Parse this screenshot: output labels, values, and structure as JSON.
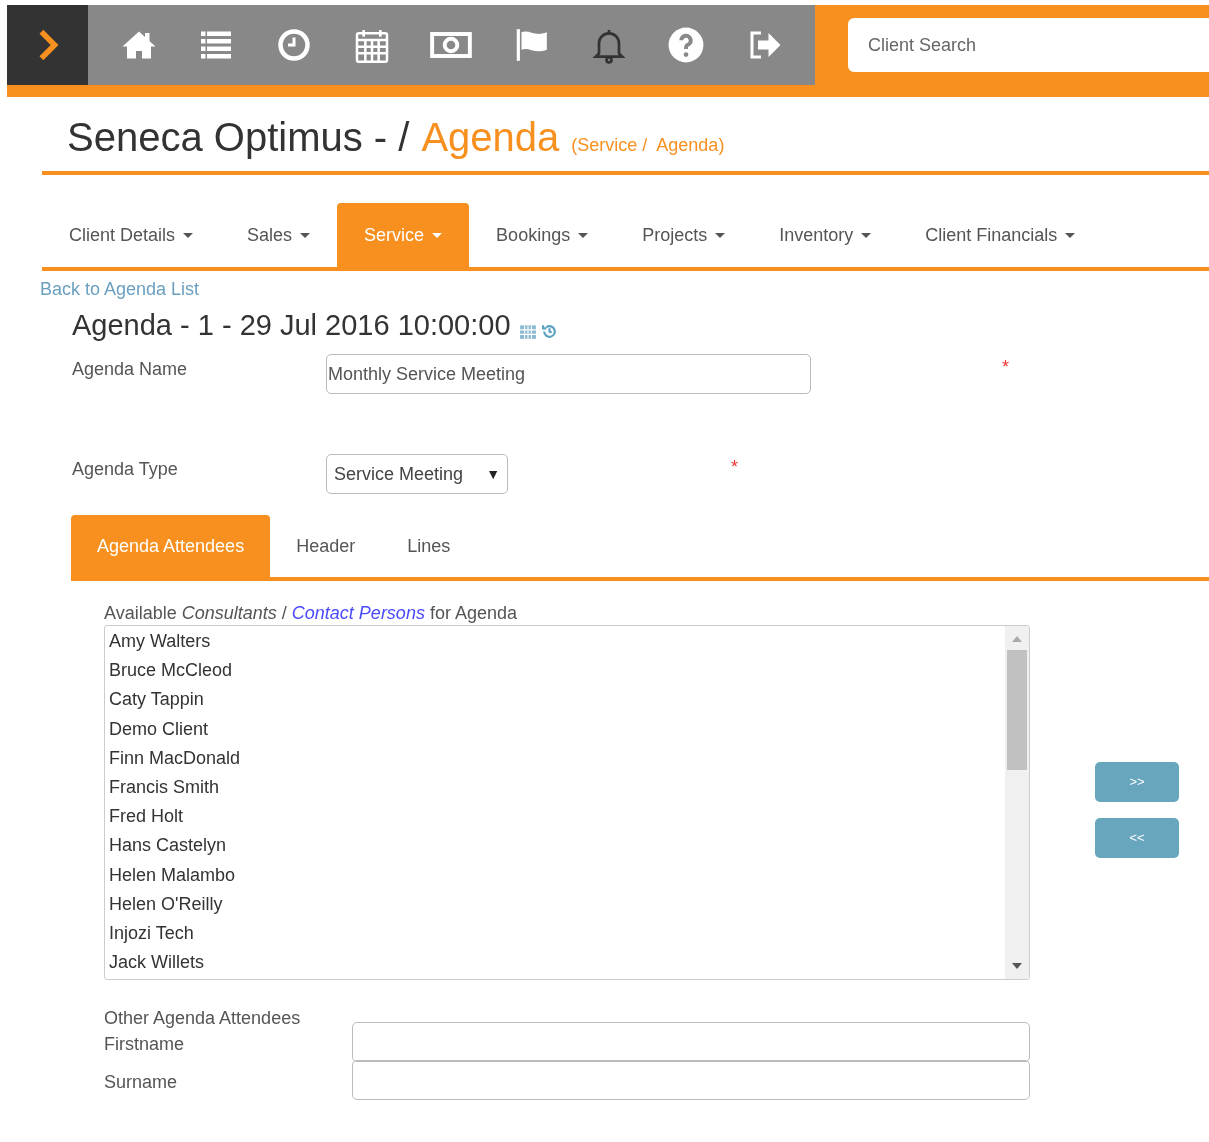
{
  "search": {
    "placeholder": "Client Search"
  },
  "title": {
    "app": "Seneca Optimus - /",
    "page": "Agenda",
    "crumbs": "(Service /  Agenda)"
  },
  "nav_tabs": [
    {
      "label": "Client Details",
      "selected": false
    },
    {
      "label": "Sales",
      "selected": false
    },
    {
      "label": "Service",
      "selected": true
    },
    {
      "label": "Bookings",
      "selected": false
    },
    {
      "label": "Projects",
      "selected": false
    },
    {
      "label": "Inventory",
      "selected": false
    },
    {
      "label": "Client Financials",
      "selected": false
    }
  ],
  "back_link": "Back to Agenda List",
  "record_title": "Agenda - 1 - 29 Jul 2016 10:00:00",
  "fields": [
    {
      "label": "Agenda Name",
      "kind": "text",
      "value": "Monthly Service Meeting",
      "required_mark": "*"
    },
    {
      "label": "Agenda Type",
      "kind": "select",
      "value": "Service Meeting",
      "arrow": "▼",
      "required_mark": "*"
    }
  ],
  "sub_tabs": [
    {
      "label": "Agenda Attendees",
      "selected": true
    },
    {
      "label": "Header",
      "selected": false
    },
    {
      "label": "Lines",
      "selected": false
    }
  ],
  "available": {
    "label_before": "Available *Consultants* /",
    "link": "Contact Persons",
    "label_after": "for Agenda",
    "items": [
      "Amy Walters",
      "Bruce McCleod",
      "Caty Tappin",
      "Demo Client",
      "Finn MacDonald",
      "Francis Smith",
      "Fred Holt",
      "Hans Castelyn",
      "Helen Malambo",
      "Helen O'Reilly",
      "Injozi Tech",
      "Jack Willets"
    ]
  },
  "move_buttons": [
    ">>",
    "<<"
  ],
  "other": {
    "heading": "Other Agenda Attendees",
    "fields": [
      {
        "label": "Firstname"
      },
      {
        "label": "Surname"
      }
    ]
  }
}
